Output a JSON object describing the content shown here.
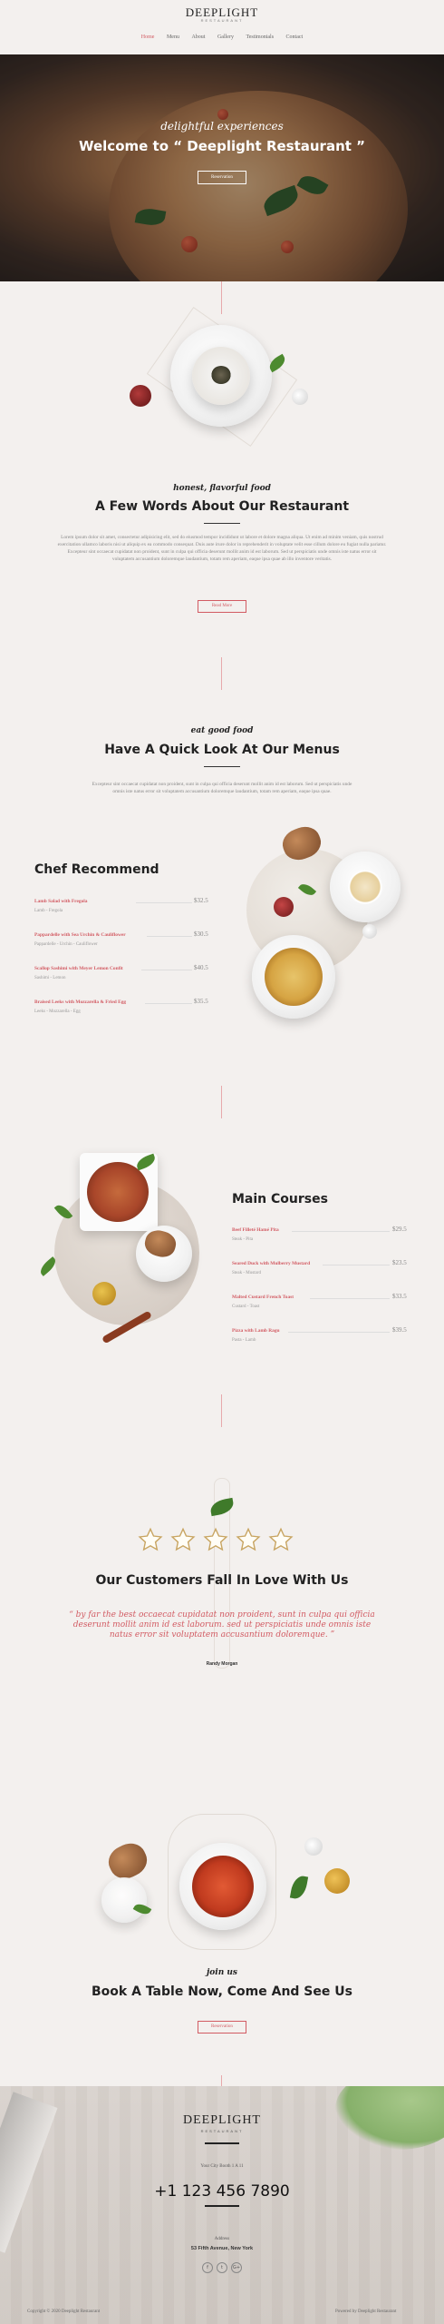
{
  "header": {
    "logo_main": "DEEPLIGHT",
    "logo_sub": "RESTAURANT",
    "nav": [
      {
        "label": "Home",
        "active": true
      },
      {
        "label": "Menu",
        "active": false
      },
      {
        "label": "About",
        "active": false
      },
      {
        "label": "Gallery",
        "active": false
      },
      {
        "label": "Testimonials",
        "active": false
      },
      {
        "label": "Contact",
        "active": false
      }
    ]
  },
  "hero": {
    "script": "delightful experiences",
    "title": "Welcome to “ Deeplight Restaurant ”",
    "button": "Reservation"
  },
  "about": {
    "script": "honest, flavorful food",
    "title": "A Few Words About Our Restaurant",
    "text": "Lorem ipsum dolor sit amet, consectetur adipisicing elit, sed do eiusmod tempor incididunt ut labore et dolore magna aliqua. Ut enim ad minim veniam, quis nostrud exercitation ullamco laboris nisi ut aliquip ex ea commodo consequat. Duis aute irure dolor in reprehenderit in voluptate velit esse cillum dolore eu fugiat nulla pariatur. Excepteur sint occaecat cupidatat non proident, sunt in culpa qui officia deserunt mollit anim id est laborum. Sed ut perspiciatis unde omnis iste natus error sit voluptatem accusantium doloremque laudantium, totam rem aperiam, eaque ipsa quae ab illo inventore veritatis.",
    "button": "Read More"
  },
  "menus_intro": {
    "script": "eat good food",
    "title": "Have A Quick Look At Our Menus",
    "text": "Excepteur sint occaecat cupidatat non proident, sunt in culpa qui officia deserunt mollit anim id est laborum. Sed ut perspiciatis unde omnis iste natus error sit voluptatem accusantium doloremque laudantium, totam rem aperiam, eaque ipsa quae."
  },
  "chef_recommend": {
    "heading": "Chef Recommend",
    "items": [
      {
        "name": "Lamb Salad with Fregola",
        "desc": "Lamb - Fregola",
        "price": "$32.5"
      },
      {
        "name": "Pappardelle with Sea Urchin & Cauliflower",
        "desc": "Pappardelle - Urchin - Cauliflower",
        "price": "$30.5"
      },
      {
        "name": "Scallop Sashimi with Meyer Lemon Confit",
        "desc": "Sashimi - Lemon",
        "price": "$40.5"
      },
      {
        "name": "Braised Leeks with Mozzarella & Fried Egg",
        "desc": "Leeks - Mozzarella - Egg",
        "price": "$35.5"
      }
    ]
  },
  "main_courses": {
    "heading": "Main Courses",
    "items": [
      {
        "name": "Beef Filleté Hamé Pita",
        "desc": "Steak - Pita",
        "price": "$29.5"
      },
      {
        "name": "Seared Duck with Mulberry Mustard",
        "desc": "Steak - Mustard",
        "price": "$23.5"
      },
      {
        "name": "Malted Custard French Toast",
        "desc": "Custard - Toast",
        "price": "$33.5"
      },
      {
        "name": "Pizza with Lamb Ragu",
        "desc": "Pasta - Lamb",
        "price": "$39.5"
      }
    ]
  },
  "testimonial": {
    "stars": 5,
    "title": "Our Customers Fall In Love With Us",
    "quote": "“ by far the best occaecat cupidatat non proident, sunt in culpa qui officia deserunt mollit anim id est laborum. sed ut perspiciatis unde omnis iste natus error sit voluptatem accusantium doloremque. ”",
    "author": "Randy Morgan"
  },
  "booking": {
    "script": "join us",
    "title": "Book A Table Now, Come And See Us",
    "button": "Reservation"
  },
  "footer": {
    "logo_main": "DEEPLIGHT",
    "logo_sub": "RESTAURANT",
    "phone_label": "Your City Booth 1 A 11",
    "phone": "+1 123 456 7890",
    "address_label": "Address",
    "address": "53 Fifth Avenue, New York",
    "social": [
      "f",
      "t",
      "G+"
    ],
    "copyright": "Copyright © 2020 Deeplight Restaurant",
    "powered": "Powered by Deeplight Restaurant"
  },
  "colors": {
    "accent": "#d25b63",
    "background": "#f3f0ee",
    "text": "#222222"
  }
}
